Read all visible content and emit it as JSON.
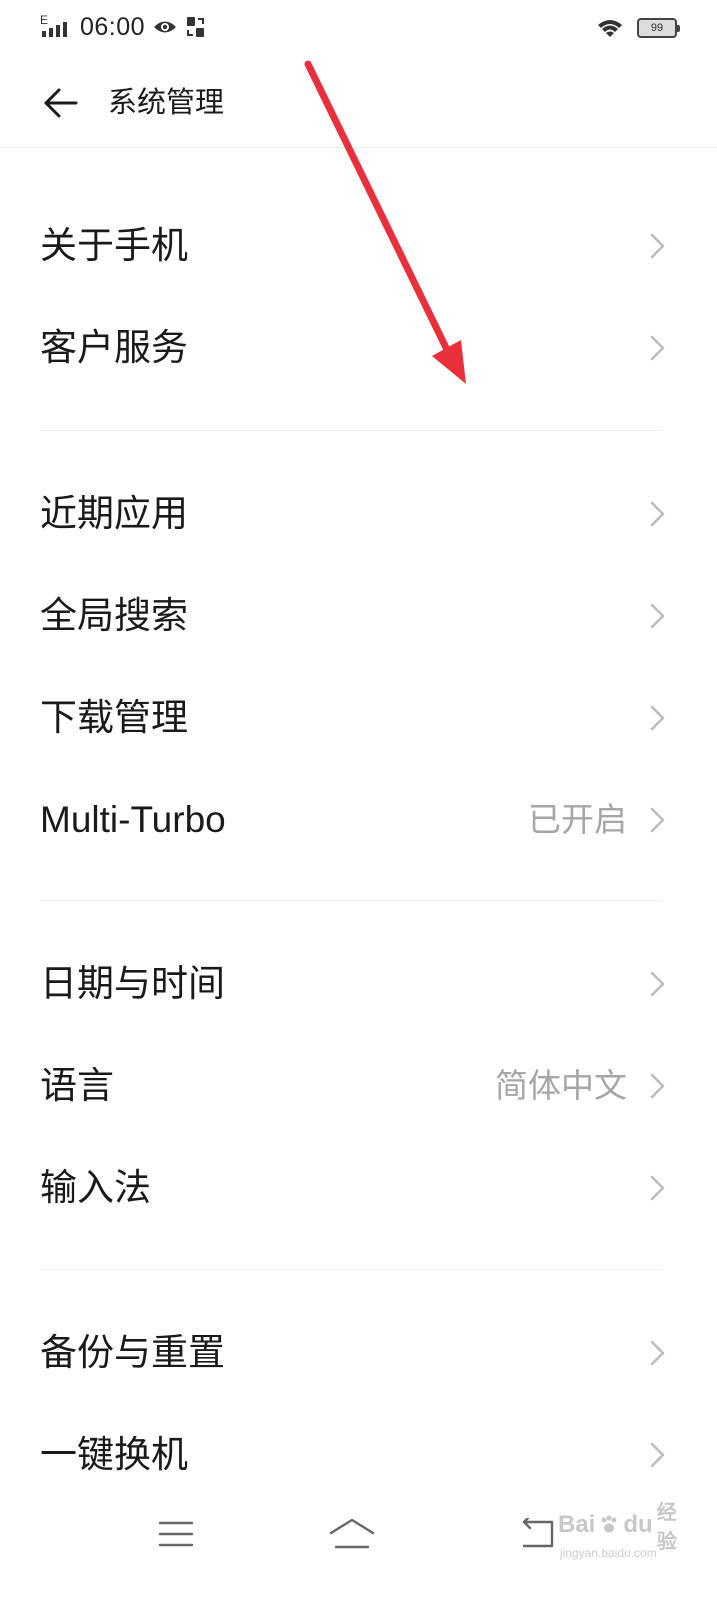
{
  "status_bar": {
    "network_type": "E",
    "time": "06:00",
    "battery_level": "99",
    "icons": [
      "signal-icon",
      "eye-icon",
      "screen-record-icon",
      "wifi-icon",
      "battery-icon"
    ]
  },
  "header": {
    "back_icon": "arrow-left-icon",
    "title": "系统管理"
  },
  "settings": {
    "groups": [
      {
        "items": [
          {
            "label": "关于手机",
            "value": ""
          },
          {
            "label": "客户服务",
            "value": ""
          }
        ]
      },
      {
        "items": [
          {
            "label": "近期应用",
            "value": ""
          },
          {
            "label": "全局搜索",
            "value": ""
          },
          {
            "label": "下载管理",
            "value": ""
          },
          {
            "label": "Multi-Turbo",
            "value": "已开启"
          }
        ]
      },
      {
        "items": [
          {
            "label": "日期与时间",
            "value": ""
          },
          {
            "label": "语言",
            "value": "简体中文"
          },
          {
            "label": "输入法",
            "value": ""
          }
        ]
      },
      {
        "items": [
          {
            "label": "备份与重置",
            "value": ""
          },
          {
            "label": "一键换机",
            "value": ""
          }
        ]
      }
    ],
    "chevron_icon": "chevron-right-icon"
  },
  "nav_bar": {
    "icons": [
      "menu-icon",
      "home-icon",
      "back-icon"
    ]
  },
  "annotation": {
    "arrow_color": "#e8303a"
  },
  "watermark": {
    "brand": "Bai",
    "suffix": "du",
    "cn": "经验",
    "site": "jingyan.baidu.com"
  }
}
